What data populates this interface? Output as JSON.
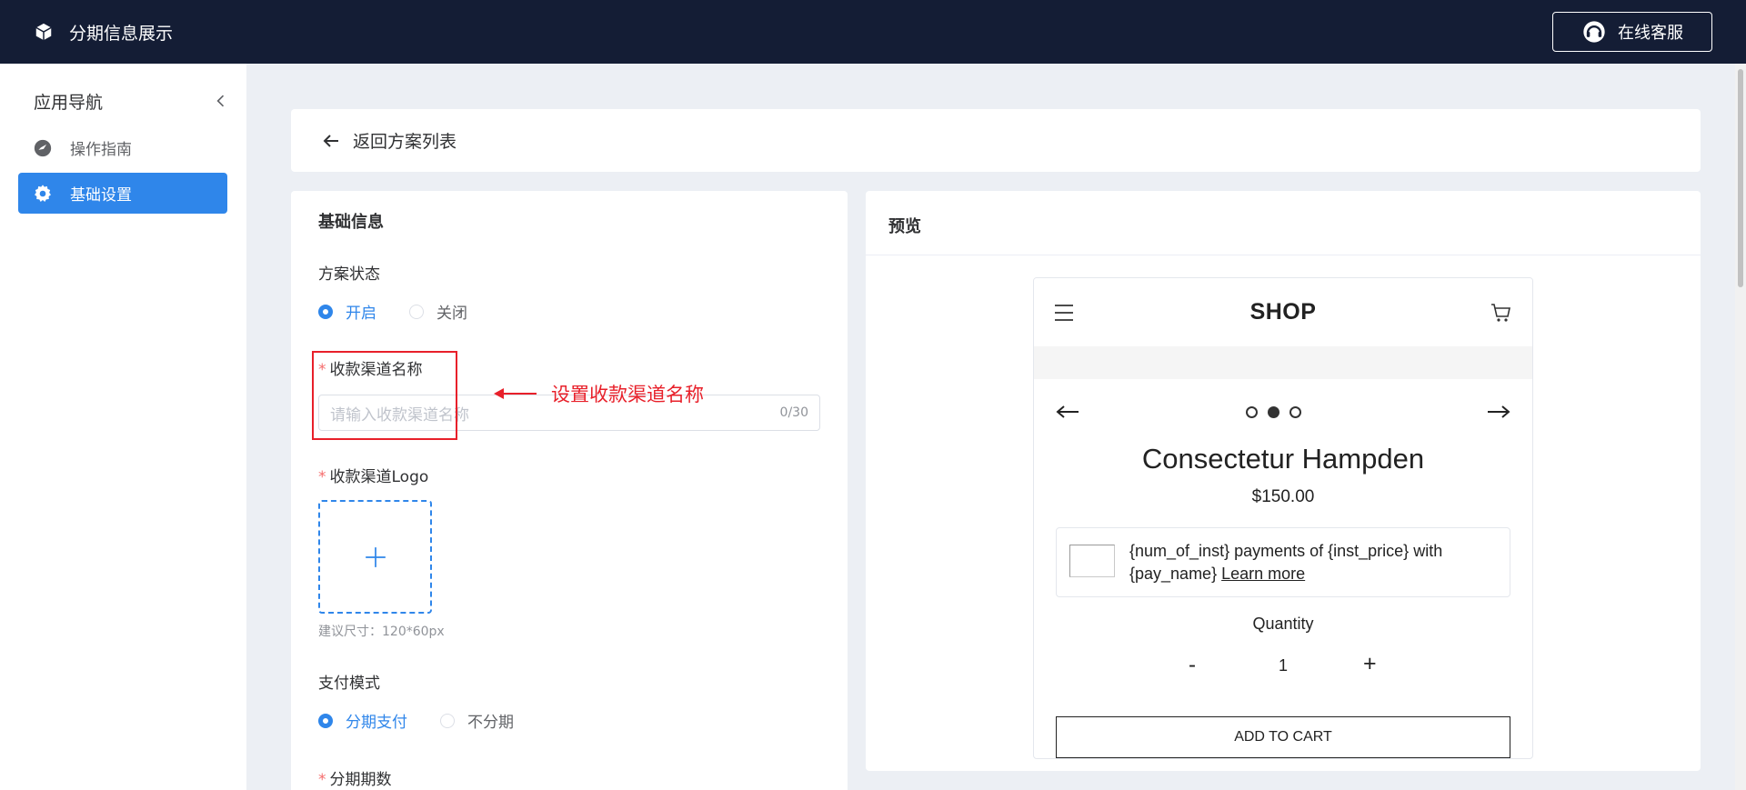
{
  "app": {
    "title": "分期信息展示",
    "support_label": "在线客服",
    "logo_icon": "cube-icon",
    "support_icon": "headset-icon"
  },
  "sidebar": {
    "title": "应用导航",
    "collapse_icon": "chevron-left-icon",
    "items": [
      {
        "label": "操作指南",
        "icon": "navigation-icon",
        "active": false
      },
      {
        "label": "基础设置",
        "icon": "gear-icon",
        "active": true
      }
    ]
  },
  "back": {
    "label": "返回方案列表",
    "icon": "arrow-left-icon"
  },
  "form": {
    "section_title": "基础信息",
    "status": {
      "label": "方案状态",
      "options": [
        "开启",
        "关闭"
      ],
      "selected": "开启"
    },
    "channel_name": {
      "required_mark": "*",
      "label": "收款渠道名称",
      "placeholder": "请输入收款渠道名称",
      "count": "0/30",
      "value": ""
    },
    "annotation": "设置收款渠道名称",
    "logo": {
      "required_mark": "*",
      "label": "收款渠道Logo",
      "hint": "建议尺寸：120*60px"
    },
    "pay_mode": {
      "label": "支付模式",
      "options": [
        "分期支付",
        "不分期"
      ],
      "selected": "分期支付"
    },
    "installments": {
      "required_mark": "*",
      "label": "分期期数"
    }
  },
  "preview": {
    "title": "预览",
    "shop": {
      "title": "SHOP",
      "product_name": "Consectetur Hampden",
      "price": "$150.00",
      "inst_text": "{num_of_inst} payments of {inst_price} with {pay_name} ",
      "learn_more": "Learn more",
      "quantity_label": "Quantity",
      "qty_minus": "-",
      "qty_value": "1",
      "qty_plus": "+",
      "add_to_cart": "ADD TO CART",
      "carousel_dots": 3,
      "carousel_active": 1
    }
  },
  "colors": {
    "primary": "#2f86ea",
    "topbar": "#141d35",
    "annotation": "#e8202a",
    "required": "#f56c6c"
  }
}
